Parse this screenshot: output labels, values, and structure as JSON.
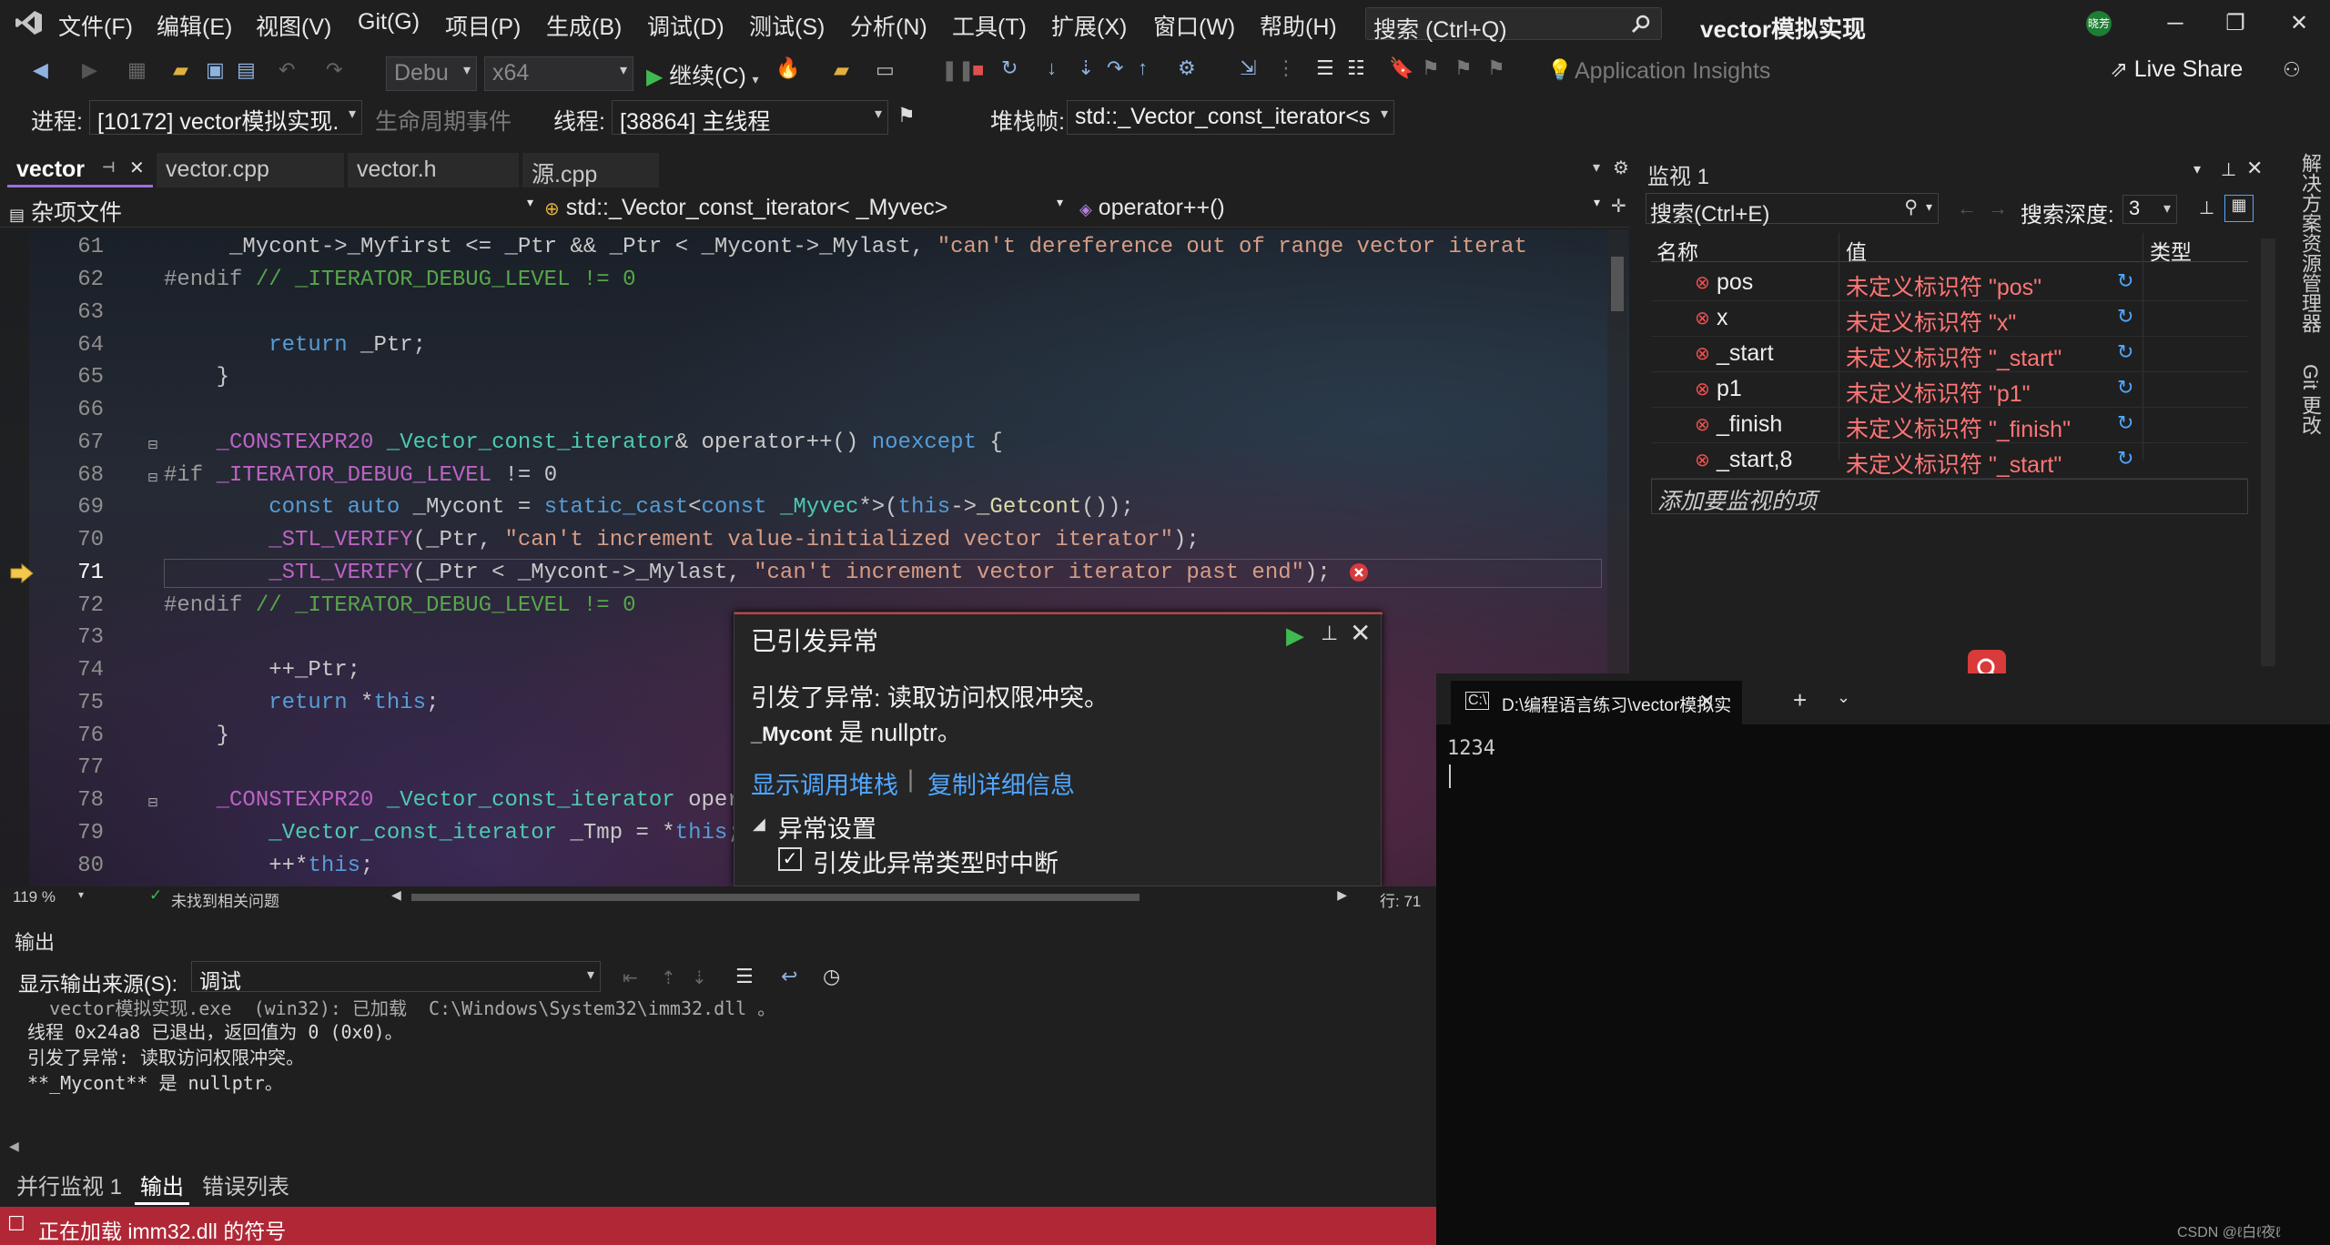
{
  "menubar": {
    "items": [
      "文件(F)",
      "编辑(E)",
      "视图(V)",
      "Git(G)",
      "项目(P)",
      "生成(B)",
      "调试(D)",
      "测试(S)",
      "分析(N)",
      "工具(T)",
      "扩展(X)",
      "窗口(W)",
      "帮助(H)"
    ],
    "search_placeholder": "搜索 (Ctrl+Q)",
    "window_title": "vector模拟实现",
    "avatar_text": "晓芳"
  },
  "toolbar1": {
    "config": "Debu",
    "platform": "x64",
    "continue_label": "继续(C)",
    "app_insights": "Application Insights",
    "live_share": "Live Share"
  },
  "toolbar2": {
    "process_label": "进程:",
    "process_value": "[10172] vector模拟实现.",
    "lifecycle_label": "生命周期事件",
    "thread_label": "线程:",
    "thread_value": "[38864] 主线程",
    "stackframe_label": "堆栈帧:",
    "stackframe_value": "std::_Vector_const_iterator<s"
  },
  "editor_tabs": [
    "vector",
    "vector.cpp",
    "vector.h",
    "源.cpp"
  ],
  "navbar": {
    "scope": "杂项文件",
    "class": "std::_Vector_const_iterator< _Myvec>",
    "member": "operator++()"
  },
  "editor": {
    "line_numbers": [
      "61",
      "62",
      "63",
      "64",
      "65",
      "66",
      "67",
      "68",
      "69",
      "70",
      "71",
      "72",
      "73",
      "74",
      "75",
      "76",
      "77",
      "78",
      "79",
      "80"
    ],
    "current_line": "71",
    "zoom": "119 %",
    "issues": "未找到相关问题",
    "position": "行: 71"
  },
  "exception": {
    "title": "已引发异常",
    "message": "引发了异常: 读取访问权限冲突。",
    "detail_var": "_Mycont",
    "detail_rest": "是 nullptr。",
    "link_callstack": "显示调用堆栈",
    "link_copy": "复制详细信息",
    "settings_header": "异常设置",
    "checkbox_label": "引发此异常类型时中断"
  },
  "output": {
    "title": "输出",
    "source_label": "显示输出来源(S):",
    "source_value": "调试",
    "lines": [
      "  vector模拟实现.exe  (win32): 已加载  C:\\Windows\\System32\\imm32.dll 。",
      "线程 0x24a8 已退出，返回值为 0 (0x0)。",
      "引发了异常: 读取访问权限冲突。",
      "**_Mycont** 是 nullptr。"
    ]
  },
  "bottom_tabs": [
    "并行监视 1",
    "输出",
    "错误列表"
  ],
  "status_text": "正在加载 imm32.dll 的符号",
  "watch": {
    "title": "监视 1",
    "search_placeholder": "搜索(Ctrl+E)",
    "depth_label": "搜索深度:",
    "depth_value": "3",
    "col_name": "名称",
    "col_value": "值",
    "col_type": "类型",
    "rows": [
      {
        "name": "pos",
        "value": "未定义标识符 \"pos\""
      },
      {
        "name": "x",
        "value": "未定义标识符 \"x\""
      },
      {
        "name": "_start",
        "value": "未定义标识符 \"_start\""
      },
      {
        "name": "p1",
        "value": "未定义标识符 \"p1\""
      },
      {
        "name": "_finish",
        "value": "未定义标识符 \"_finish\""
      },
      {
        "name": "_start,8",
        "value": "未定义标识符 \"_start\""
      }
    ],
    "add_placeholder": "添加要监视的项"
  },
  "side_tabs": [
    "解决方案资源管理器",
    "Git 更改"
  ],
  "terminal": {
    "tab_title": "D:\\编程语言练习\\vector模拟实",
    "output": "1234"
  },
  "watermark": "CSDN @ℓ白ℓ夜ℓ",
  "colors": {
    "accent": "#9b6fe0",
    "status_bar": "#b02836",
    "error": "#d83b3b",
    "link": "#4fa7ff",
    "string": "#d69d85",
    "keyword": "#569cd6",
    "type": "#4ec9b0"
  }
}
